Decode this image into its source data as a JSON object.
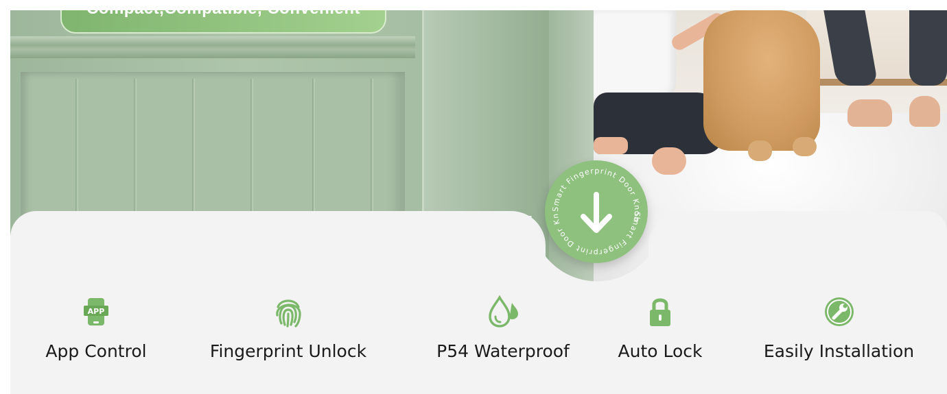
{
  "hero": {
    "slogan": "Compact,Compatible, Convenient",
    "badge_text": "Smart Fingerprint Door Knob",
    "badge_icon": "arrow-down-icon"
  },
  "features": [
    {
      "label": "App Control",
      "icon": "app-phone-icon"
    },
    {
      "label": "Fingerprint Unlock",
      "icon": "fingerprint-icon"
    },
    {
      "label": "P54 Waterproof",
      "icon": "water-drop-icon"
    },
    {
      "label": "Auto Lock",
      "icon": "padlock-icon"
    },
    {
      "label": "Easily Installation",
      "icon": "wrench-icon"
    }
  ],
  "colors": {
    "accent": "#7cb86a",
    "card": "#f3f3f3",
    "door": "#a9c0a6"
  }
}
